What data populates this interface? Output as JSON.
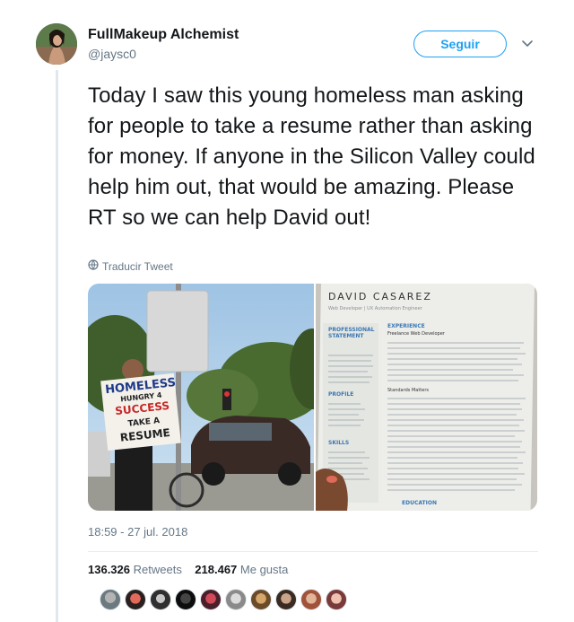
{
  "author": {
    "name": "FullMakeup Alchemist",
    "handle": "@jaysc0"
  },
  "follow_label": "Seguir",
  "tweet": {
    "text": "Today I saw this young homeless man asking for people to take a resume rather than asking for money. If anyone in the Silicon Valley could help him out, that would be amazing. Please RT so we can help David out!",
    "translate_label": "Traducir Tweet",
    "timestamp": "18:59 - 27 jul. 2018"
  },
  "sign": {
    "line1": "HOMELESS",
    "line2": "HUNGRY 4",
    "line3": "SUCCESS",
    "line4": "TAKE A",
    "line5": "RESUME"
  },
  "resume": {
    "name": "DAVID CASAREZ",
    "subtitle": "Web Developer | UX Automation Engineer",
    "section_professional": "PROFESSIONAL STATEMENT",
    "section_experience": "EXPERIENCE",
    "section_profile": "PROFILE",
    "section_skills": "SKILLS",
    "section_education": "EDUCATION",
    "job1": "Freelance Web Developer",
    "job2": "Standards Matters"
  },
  "stats": {
    "retweets_count": "136.326",
    "retweets_label": "Retweets",
    "likes_count": "218.467",
    "likes_label": "Me gusta"
  },
  "colors": {
    "accent": "#1da1f2",
    "secondary_text": "#657786",
    "divider": "#e6ecf0"
  },
  "icons": {
    "menu": "chevron-down-icon",
    "translate": "globe-icon"
  }
}
